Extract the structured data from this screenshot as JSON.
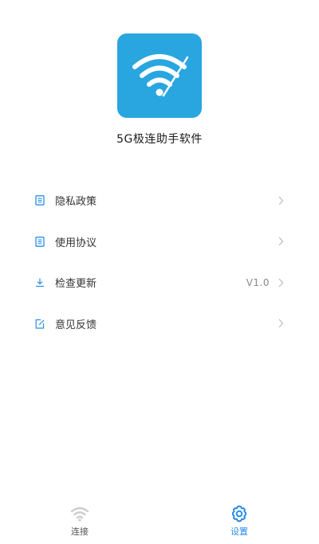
{
  "app": {
    "name": "5G极连助手软件",
    "logo_icon": "wifi-icon",
    "accent": "#29a6e0"
  },
  "menu": {
    "items": [
      {
        "label": "隐私政策",
        "icon": "document-icon",
        "value": ""
      },
      {
        "label": "使用协议",
        "icon": "document-icon",
        "value": ""
      },
      {
        "label": "检查更新",
        "icon": "download-icon",
        "value": "V1.0"
      },
      {
        "label": "意见反馈",
        "icon": "edit-icon",
        "value": ""
      }
    ]
  },
  "tabbar": {
    "tabs": [
      {
        "label": "连接",
        "icon": "wifi-icon",
        "active": false
      },
      {
        "label": "设置",
        "icon": "gear-icon",
        "active": true
      }
    ],
    "active_color": "#2a8de8",
    "inactive_color": "#cccccc"
  }
}
